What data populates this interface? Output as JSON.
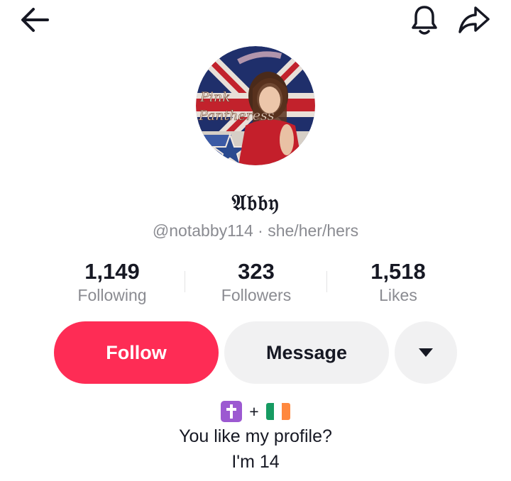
{
  "header": {
    "back_icon": "arrow-left-icon",
    "notification_icon": "bell-icon",
    "share_icon": "share-arrow-icon"
  },
  "profile": {
    "avatar_text_line1": "Pink",
    "avatar_text_line2": "Pantheress",
    "display_name": "𝔄𝔟𝔟𝔶",
    "handle_line": "@notabby114 · she/her/hers"
  },
  "stats": [
    {
      "value": "1,149",
      "label": "Following"
    },
    {
      "value": "323",
      "label": "Followers"
    },
    {
      "value": "1,518",
      "label": "Likes"
    }
  ],
  "actions": {
    "follow_label": "Follow",
    "message_label": "Message",
    "more_icon": "caret-down-icon"
  },
  "bio": {
    "emoji_cross": "✝️",
    "plus": "+",
    "emoji_flag": "🇮🇪",
    "line1": "You like my profile?",
    "line2": "I'm 14"
  },
  "colors": {
    "accent": "#fe2c55",
    "secondary_button": "#f1f1f2",
    "muted_text": "#8a8b91",
    "cross_emoji_bg": "#9c59d1",
    "flag_green": "#169b62",
    "flag_white": "#ffffff",
    "flag_orange": "#ff883e"
  }
}
